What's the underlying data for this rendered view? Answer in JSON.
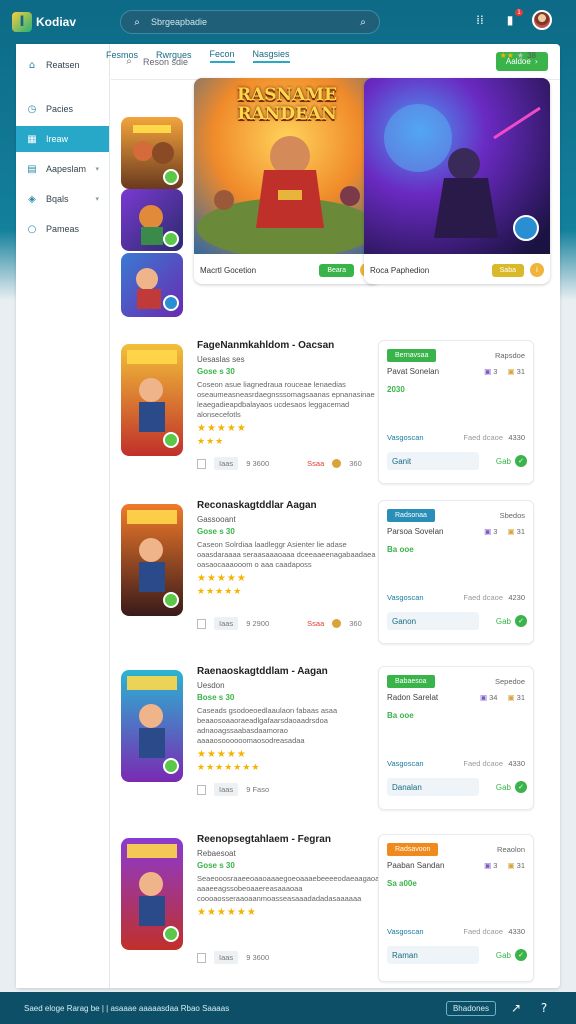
{
  "app": {
    "name": "Kodiav",
    "logo_letter": "I"
  },
  "search": {
    "placeholder": "Sbrgeapbadie"
  },
  "sidebar": {
    "items": [
      {
        "label": "Reatsen",
        "icon": "home-icon"
      },
      {
        "label": "Pacies",
        "icon": "clock-icon"
      },
      {
        "label": "Ireaw",
        "icon": "grid-icon",
        "active": true
      },
      {
        "label": "Aapeslam",
        "icon": "bookmark-icon",
        "caret": true
      },
      {
        "label": "Bqals",
        "icon": "tag-icon",
        "caret": true
      },
      {
        "label": "Pameas",
        "icon": "circle-icon"
      }
    ]
  },
  "header": {
    "search_text": "Reson sdie",
    "button_label": "Aaldoe"
  },
  "tabs": [
    "Fesmos",
    "Rwrgues",
    "Fecon",
    "Nasgsies"
  ],
  "top_rating": {
    "stars": 2,
    "count": "38"
  },
  "featured": [
    {
      "title": "Macrtl Gocetion",
      "art_title": "RASNAME RANDEAN",
      "button": "Beara",
      "button_color": "#3ab44a"
    },
    {
      "title": "Roca Paphedion",
      "button": "Saba",
      "button_color": "#d9b82a"
    }
  ],
  "games": [
    {
      "title": "FageNanmkahldom - Oacsan",
      "sub": "Uesaslas ses",
      "price": "Gose s 30",
      "desc": "Coseon asue liagnedraua rouceae lenaedias oseaumeasneasrdaegnsssomagsaanas epnanasinae leaegadieapdbalayaos ucdesaos leggacemad alonsecefotls",
      "stars": 5,
      "stars2": 3,
      "meta1": "Iaas",
      "meta2": "9 3600",
      "meta3": "Ssaa",
      "meta4": "360"
    },
    {
      "title": "Reconaskagtddlar Aagan",
      "sub": "Gassooant",
      "price": "Gose s 30",
      "desc": "Caseon Solrdiaa laadleggr Asienter lie adase oaasdaraaaa seraasaaaoaaa dceeaaeenagabaadaea oasaocaaaooom o aaa caadaposs",
      "stars": 5,
      "stars2": 5,
      "meta1": "Iaas",
      "meta2": "9 2900",
      "meta3": "Ssaa",
      "meta4": "360"
    },
    {
      "title": "Raenaoskagtddlam - Aagan",
      "sub": "Uesdon",
      "price": "Bose s 30",
      "desc": "Caseads gsodoeoedlaaulaon fabaas asaa beaaosoaaoraeadlgafaarsdaoaadrsdoa adnaoagssaabasdaamorao aaaaosoooooomaosodreasadaa",
      "stars": 5,
      "stars2": 7,
      "meta1": "Iaas",
      "meta2": "9 Faso"
    },
    {
      "title": "Reenopsegtahlaem - Fegran",
      "sub": "Rebaesoat",
      "price": "Gose s 30",
      "desc": "Seaeooosraaeeoaaoaaaegoeoaaaebeeeeodaeaagaoaaaa aaaeeagssobeoaaereasaaaoaa coooaosseraaoaanmoasseasaaadadadasaaaaaa",
      "stars": 6,
      "stars2": 0,
      "meta1": "Iaas",
      "meta2": "9 3600"
    }
  ],
  "sidecards": [
    {
      "tag": "Bernavsaa",
      "tag_color": "#3ab44a",
      "top": "Rapsdoe",
      "l1": "Pavat Sonelan",
      "s1": "3",
      "s2": "31",
      "l2": "2030",
      "l3": "Vasgoscan",
      "l3b": "Faed dcaoe",
      "l3c": "4330",
      "field": "Ganit",
      "go": "Gab"
    },
    {
      "tag": "Radsonaa",
      "tag_color": "#2a8fb8",
      "top": "Sbedos",
      "l1": "Parsoa Sovelan",
      "s1": "3",
      "s2": "31",
      "l2": "Ba ooe",
      "l3": "Vasgoscan",
      "l3b": "Faed dcaoe",
      "l3c": "4230",
      "field": "Ganon",
      "go": "Gab"
    },
    {
      "tag": "Babaesoa",
      "tag_color": "#3ab44a",
      "top": "Sepedoe",
      "l1": "Radon Sarelat",
      "s1": "34",
      "s2": "31",
      "l2": "Ba ooe",
      "l3": "Vasgoscan",
      "l3b": "Faed dcaoe",
      "l3c": "4330",
      "field": "Danalan",
      "go": "Gab"
    },
    {
      "tag": "Radsavoon",
      "tag_color": "#f08a1c",
      "top": "Reaolon",
      "l1": "Paaban Sandan",
      "s1": "3",
      "s2": "31",
      "l2": "Sa a00e",
      "l3": "Vasgoscan",
      "l3b": "Faed dcaoe",
      "l3c": "4330",
      "field": "Raman",
      "go": "Gab"
    }
  ],
  "footer": {
    "left": "Saed eloge Rarag be |  | asaaae aaaaasdaa Rbao Saaaas",
    "button": "Bhadones"
  },
  "colors": {
    "brand": "#0d6a86",
    "accent": "#28a8c8",
    "green": "#3ab44a"
  }
}
